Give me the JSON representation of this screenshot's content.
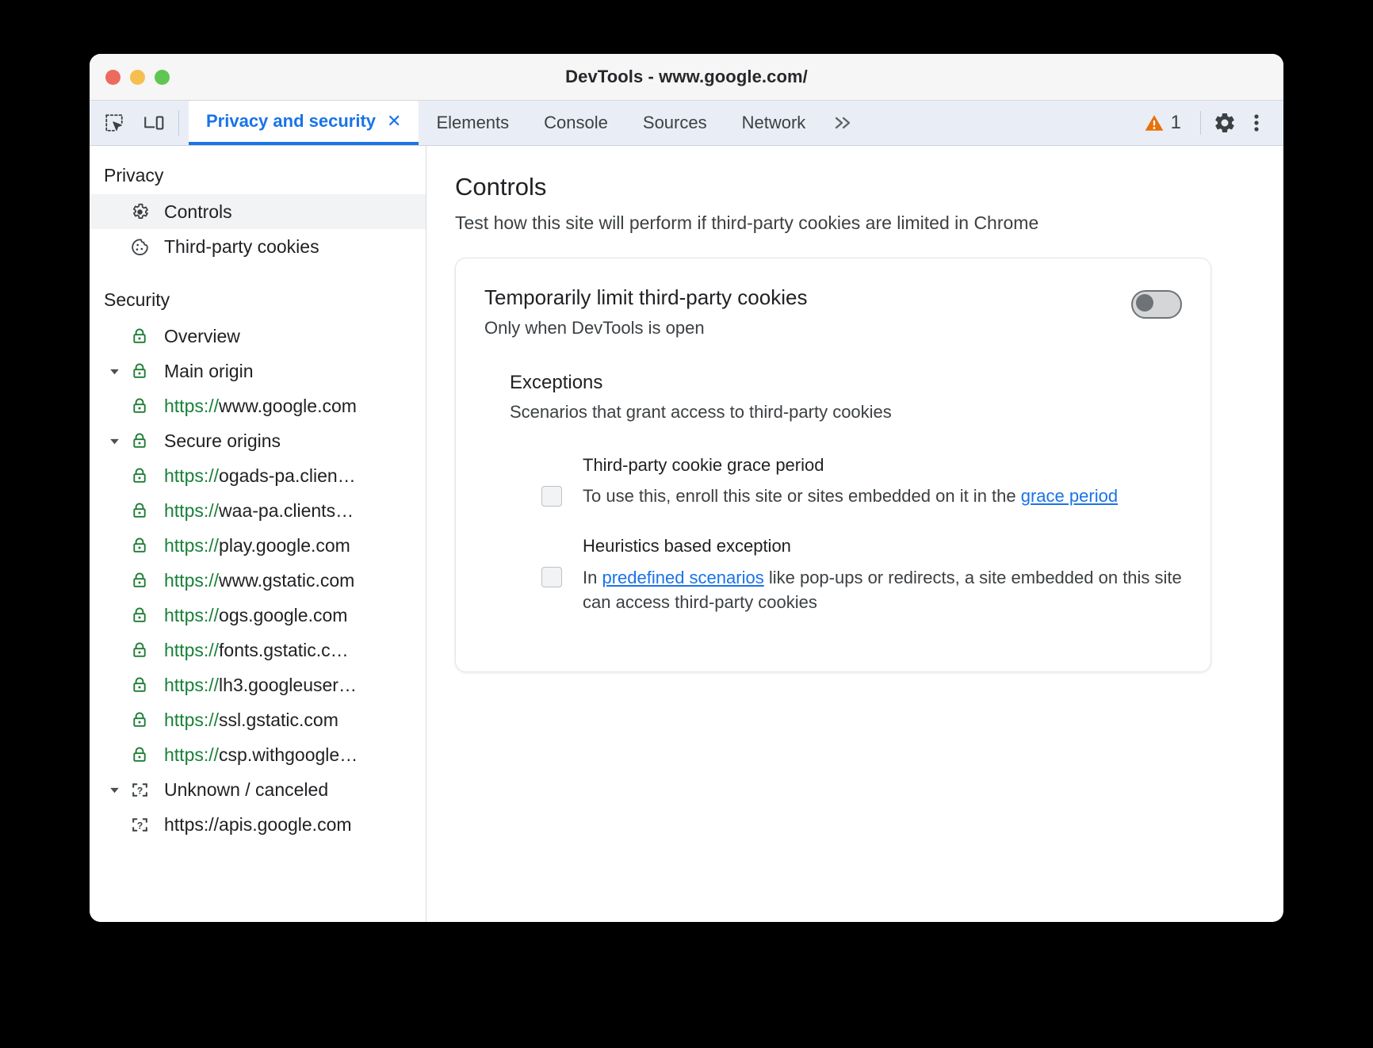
{
  "window": {
    "title": "DevTools - www.google.com/",
    "traffic_lights": [
      "close",
      "minimize",
      "zoom"
    ]
  },
  "toolbar": {
    "inspect_icon": "inspect-element-icon",
    "device_icon": "device-toolbar-icon",
    "overflow_label": "»",
    "warning_icon": "warning-triangle-icon",
    "warning_count": "1",
    "settings_icon": "gear-icon",
    "more_icon": "more-vertical-icon"
  },
  "tabs": [
    {
      "label": "Privacy and security",
      "active": true,
      "closable": true,
      "close_label": "✕"
    },
    {
      "label": "Elements",
      "active": false,
      "closable": false
    },
    {
      "label": "Console",
      "active": false,
      "closable": false
    },
    {
      "label": "Sources",
      "active": false,
      "closable": false
    },
    {
      "label": "Network",
      "active": false,
      "closable": false
    }
  ],
  "sidebar": {
    "groups": [
      {
        "title": "Privacy",
        "items": [
          {
            "label": "Controls",
            "icon": "gear-icon",
            "selected": true,
            "indent": 0,
            "expandable": false
          },
          {
            "label": "Third-party cookies",
            "icon": "cookie-icon",
            "selected": false,
            "indent": 0,
            "expandable": false
          }
        ]
      },
      {
        "title": "Security",
        "items": [
          {
            "label": "Overview",
            "icon": "lock-icon",
            "selected": false,
            "indent": 0,
            "expandable": false
          },
          {
            "label": "Main origin",
            "icon": "lock-icon",
            "selected": false,
            "indent": 0,
            "expandable": true,
            "expanded": true
          },
          {
            "scheme": "https://",
            "host": "www.google.com",
            "icon": "lock-icon",
            "selected": false,
            "indent": 1,
            "expandable": false
          },
          {
            "label": "Secure origins",
            "icon": "lock-icon",
            "selected": false,
            "indent": 0,
            "expandable": true,
            "expanded": true
          },
          {
            "scheme": "https://",
            "host": "ogads-pa.clien…",
            "icon": "lock-icon",
            "selected": false,
            "indent": 1,
            "expandable": false
          },
          {
            "scheme": "https://",
            "host": "waa-pa.clients…",
            "icon": "lock-icon",
            "selected": false,
            "indent": 1,
            "expandable": false
          },
          {
            "scheme": "https://",
            "host": "play.google.com",
            "icon": "lock-icon",
            "selected": false,
            "indent": 1,
            "expandable": false
          },
          {
            "scheme": "https://",
            "host": "www.gstatic.com",
            "icon": "lock-icon",
            "selected": false,
            "indent": 1,
            "expandable": false
          },
          {
            "scheme": "https://",
            "host": "ogs.google.com",
            "icon": "lock-icon",
            "selected": false,
            "indent": 1,
            "expandable": false
          },
          {
            "scheme": "https://",
            "host": "fonts.gstatic.c…",
            "icon": "lock-icon",
            "selected": false,
            "indent": 1,
            "expandable": false
          },
          {
            "scheme": "https://",
            "host": "lh3.googleuser…",
            "icon": "lock-icon",
            "selected": false,
            "indent": 1,
            "expandable": false
          },
          {
            "scheme": "https://",
            "host": "ssl.gstatic.com",
            "icon": "lock-icon",
            "selected": false,
            "indent": 1,
            "expandable": false
          },
          {
            "scheme": "https://",
            "host": "csp.withgoogle…",
            "icon": "lock-icon",
            "selected": false,
            "indent": 1,
            "expandable": false
          },
          {
            "label": "Unknown / canceled",
            "icon": "unknown-origin-icon",
            "selected": false,
            "indent": 0,
            "expandable": true,
            "expanded": true
          },
          {
            "label": "https://apis.google.com",
            "icon": "unknown-origin-icon",
            "selected": false,
            "indent": 1,
            "expandable": false,
            "plain": true
          }
        ]
      }
    ]
  },
  "main": {
    "title": "Controls",
    "subtitle": "Test how this site will perform if third-party cookies are limited in Chrome",
    "card": {
      "title": "Temporarily limit third-party cookies",
      "subtitle": "Only when DevTools is open",
      "toggle": {
        "name": "limit-third-party-cookies-toggle",
        "checked": false
      },
      "exceptions": {
        "title": "Exceptions",
        "subtitle": "Scenarios that grant access to third-party cookies",
        "rows": [
          {
            "heading": "Third-party cookie grace period",
            "checked": false,
            "desc_before": "To use this, enroll this site or sites embedded on it in the ",
            "link": "grace period",
            "desc_after": ""
          },
          {
            "heading": "Heuristics based exception",
            "checked": false,
            "desc_before": "In ",
            "link": "predefined scenarios",
            "desc_after": " like pop-ups or redirects, a site embedded on this site can access third-party cookies"
          }
        ]
      }
    }
  },
  "colors": {
    "accent": "#1a73e8",
    "secure_green": "#188038",
    "warning_orange": "#e8710a",
    "tabbar_bg": "#e9eef6"
  }
}
